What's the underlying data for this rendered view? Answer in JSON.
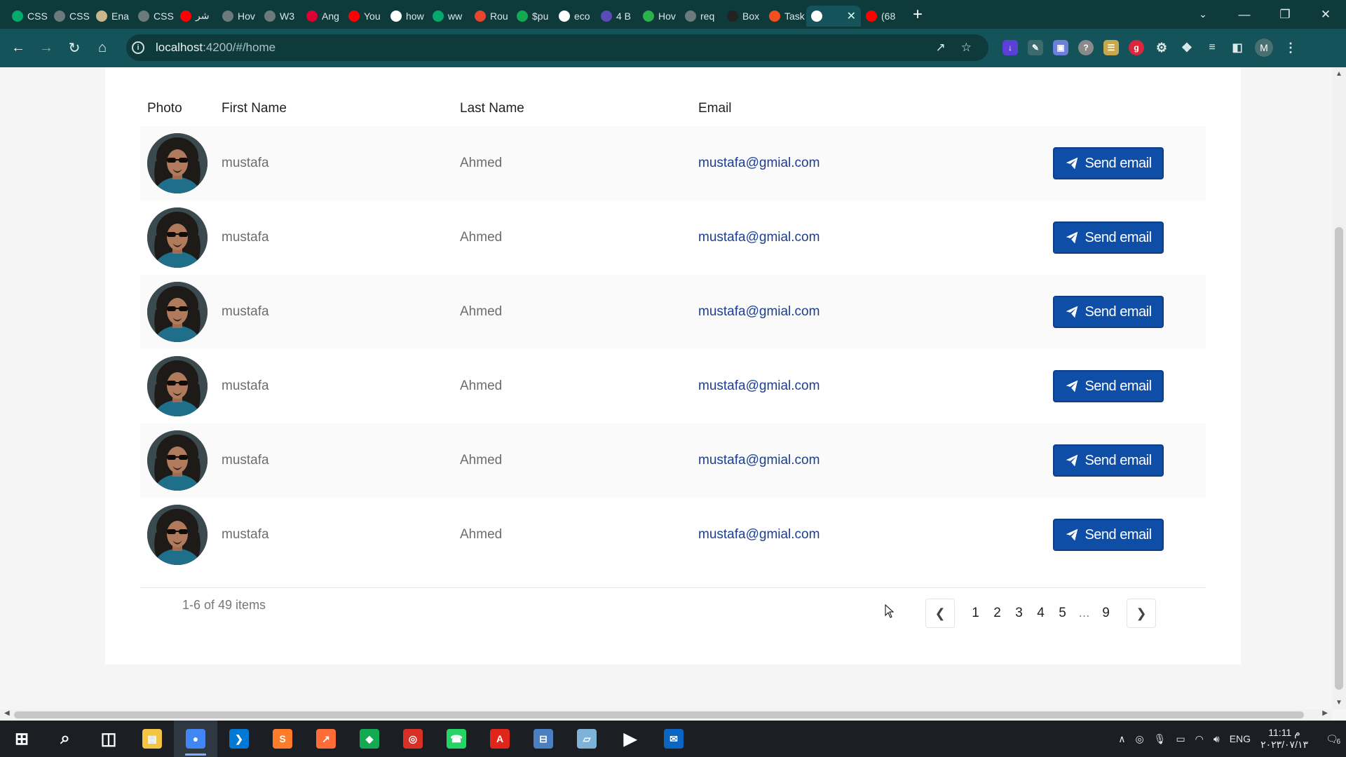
{
  "browser": {
    "tabs": [
      {
        "label": "CSS",
        "icon": "w3schools-icon",
        "color": "#04aa6d"
      },
      {
        "label": "CSS",
        "icon": "globe-icon",
        "color": "#6c7a7b"
      },
      {
        "label": "Ena",
        "icon": "avatar-icon",
        "color": "#c8b68c"
      },
      {
        "label": "CSS",
        "icon": "globe-icon",
        "color": "#6c7a7b"
      },
      {
        "label": "شر",
        "icon": "youtube-icon",
        "color": "#ff0000"
      },
      {
        "label": "Hov",
        "icon": "globe-icon",
        "color": "#6c7a7b"
      },
      {
        "label": "W3",
        "icon": "globe-icon",
        "color": "#6c7a7b"
      },
      {
        "label": "Ang",
        "icon": "angular-icon",
        "color": "#dd0031"
      },
      {
        "label": "You",
        "icon": "youtube-icon",
        "color": "#ff0000"
      },
      {
        "label": "how",
        "icon": "google-icon",
        "color": "#ffffff"
      },
      {
        "label": "ww",
        "icon": "w3schools-icon",
        "color": "#04aa6d"
      },
      {
        "label": "Rou",
        "icon": "bookmark-icon",
        "color": "#e8452c"
      },
      {
        "label": "$pu",
        "icon": "mongodb-icon",
        "color": "#13aa52"
      },
      {
        "label": "eco",
        "icon": "google-icon",
        "color": "#ffffff"
      },
      {
        "label": "4 B",
        "icon": "colors-icon",
        "color": "#5b4bb7"
      },
      {
        "label": "Hov",
        "icon": "feedly-icon",
        "color": "#2bb24c"
      },
      {
        "label": "req",
        "icon": "globe-icon",
        "color": "#6c7a7b"
      },
      {
        "label": "Box",
        "icon": "code-icon",
        "color": "#222222"
      },
      {
        "label": "Task",
        "icon": "figma-icon",
        "color": "#f24e1e"
      },
      {
        "label": "",
        "icon": "angular-icon",
        "color": "#ffffff",
        "active": true
      },
      {
        "label": "(68",
        "icon": "youtube-icon",
        "color": "#ff0000"
      }
    ],
    "new_tab": "+",
    "url_host": "localhost",
    "url_rest": ":4200/#/home"
  },
  "table": {
    "headers": {
      "photo": "Photo",
      "first_name": "First Name",
      "last_name": "Last Name",
      "email": "Email"
    },
    "rows": [
      {
        "first_name": "mustafa",
        "last_name": "Ahmed",
        "email": "mustafa@gmial.com",
        "action": "Send email"
      },
      {
        "first_name": "mustafa",
        "last_name": "Ahmed",
        "email": "mustafa@gmial.com",
        "action": "Send email"
      },
      {
        "first_name": "mustafa",
        "last_name": "Ahmed",
        "email": "mustafa@gmial.com",
        "action": "Send email"
      },
      {
        "first_name": "mustafa",
        "last_name": "Ahmed",
        "email": "mustafa@gmial.com",
        "action": "Send email"
      },
      {
        "first_name": "mustafa",
        "last_name": "Ahmed",
        "email": "mustafa@gmial.com",
        "action": "Send email"
      },
      {
        "first_name": "mustafa",
        "last_name": "Ahmed",
        "email": "mustafa@gmial.com",
        "action": "Send email"
      }
    ]
  },
  "pagination": {
    "summary": "1-6 of 49 items",
    "pages": [
      "1",
      "2",
      "3",
      "4",
      "5",
      "...",
      "9"
    ]
  },
  "taskbar": {
    "apps": [
      {
        "icon": "windows-start-icon",
        "color": "#ffffff"
      },
      {
        "icon": "search-icon",
        "color": "#ffffff"
      },
      {
        "icon": "task-view-icon",
        "color": "#ffffff"
      },
      {
        "icon": "file-explorer-icon",
        "color": "#f4c542"
      },
      {
        "icon": "chrome-icon",
        "color": "#4285f4",
        "active": true
      },
      {
        "icon": "vscode-icon",
        "color": "#0078d4"
      },
      {
        "icon": "sublime-icon",
        "color": "#ff7a29"
      },
      {
        "icon": "postman-icon",
        "color": "#ff6c37"
      },
      {
        "icon": "mongodb-compass-icon",
        "color": "#13aa52"
      },
      {
        "icon": "chrome-canary-icon",
        "color": "#d93025"
      },
      {
        "icon": "whatsapp-icon",
        "color": "#25d366"
      },
      {
        "icon": "acrobat-icon",
        "color": "#e0251b"
      },
      {
        "icon": "calculator-icon",
        "color": "#4a7fc1"
      },
      {
        "icon": "notepad-icon",
        "color": "#7fb2d8"
      },
      {
        "icon": "media-player-icon",
        "color": "#ffffff"
      },
      {
        "icon": "mail-icon",
        "color": "#0a66c2"
      }
    ],
    "language": "ENG",
    "time": "11:11 م",
    "date": "٢٠٢٣/٠٧/١٣",
    "notification_count": "6"
  }
}
